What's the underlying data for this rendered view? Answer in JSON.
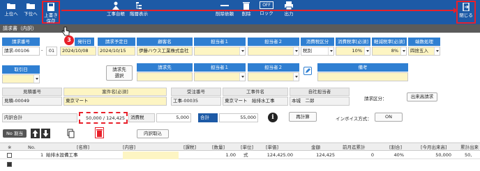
{
  "toolbar": {
    "prev": "上位へ",
    "next": "下位へ",
    "save": "上書き\n保存",
    "koji_daicho": "工事台帳",
    "kaiso": "階層表示",
    "del_request": "削除依頼",
    "del": "削除",
    "lock": "ロック",
    "lock_state": "OFF",
    "output": "出力",
    "close": "閉じる"
  },
  "window_title": "請求書（内訳）",
  "step_badge": "3",
  "colors": {
    "toolbar": "#1d5aa6",
    "label": "#2f7fd2",
    "highlight": "#e8202a",
    "field_yellow": "#fdf5c3"
  },
  "row1": {
    "labels": {
      "seikyu_no": "請求番号",
      "hakko": "発行日",
      "yotei": "請求予定日",
      "kokyaku": "顧客名",
      "tanto1": "担当者１",
      "tanto2": "担当者２",
      "tax_kubun": "消費税区分",
      "tax_rate": "消費税率[必須]",
      "keigen": "軽減税率[必須]",
      "hasu": "端数処理"
    },
    "values": {
      "seikyu_no": "請求-00106",
      "sep": "-",
      "branch": "01",
      "hakko": "2024/10/08",
      "yotei": "2024/10/15",
      "kokyaku": "伊藤ハウス工業株式会社",
      "tanto1": "",
      "tanto2": "",
      "tax_kubun": "税別",
      "tax_rate": "10%",
      "keigen": "8%",
      "hasu": "四捨五入"
    }
  },
  "row2": {
    "labels": {
      "torihiki": "取引日",
      "seikyusaki_btn": "請求先\n選択",
      "seikyusaki": "請求先",
      "tanto1": "担当者１",
      "tanto2": "担当者２",
      "biko": "備考"
    },
    "values": {
      "torihiki": "",
      "seikyusaki": "",
      "tanto1": "",
      "tanto2": "",
      "biko": ""
    }
  },
  "row3": {
    "labels": {
      "mitsumori_no": "見積番号",
      "anken": "案件名[必須]",
      "juchu_no": "受注番号",
      "koji_name": "工事件名",
      "jisha": "自社担当者",
      "kubun": "請求区分：",
      "dekidaka_btn": "出来高請求"
    },
    "values": {
      "mitsumori_no": "見積-00049",
      "anken": "東京マート",
      "juchu_no": "工事-00035",
      "koji_name": "東京マート　給排水工事",
      "jisha": "本城　二郎"
    }
  },
  "row4": {
    "uchiwake_label": "内訳合計",
    "uchiwake_value": "50,000 / 124,425",
    "tax_label": "消費税",
    "tax_value": "5,000",
    "total_label": "合計",
    "total_value": "55,000",
    "recalc": "再計算",
    "invoice_label": "インボイス方式：",
    "invoice_value": "ON"
  },
  "row5": {
    "no_label": "No 割当",
    "uchiwake_torikomi": "内訳取込"
  },
  "table": {
    "headers": [
      "※",
      "No.",
      "[名称]",
      "[内容]",
      "[課税]",
      "[数量]",
      "[単位]",
      "[単価]",
      "金額",
      "前月迄累計",
      "[割合]",
      "[今月出来高]",
      "累計出来"
    ],
    "rows": [
      [
        "",
        "1",
        "給排水設備工事",
        "",
        "",
        "1.00",
        "式",
        "124,425.00",
        "124,425",
        "0",
        "40%",
        "50,000",
        "50,"
      ]
    ]
  }
}
